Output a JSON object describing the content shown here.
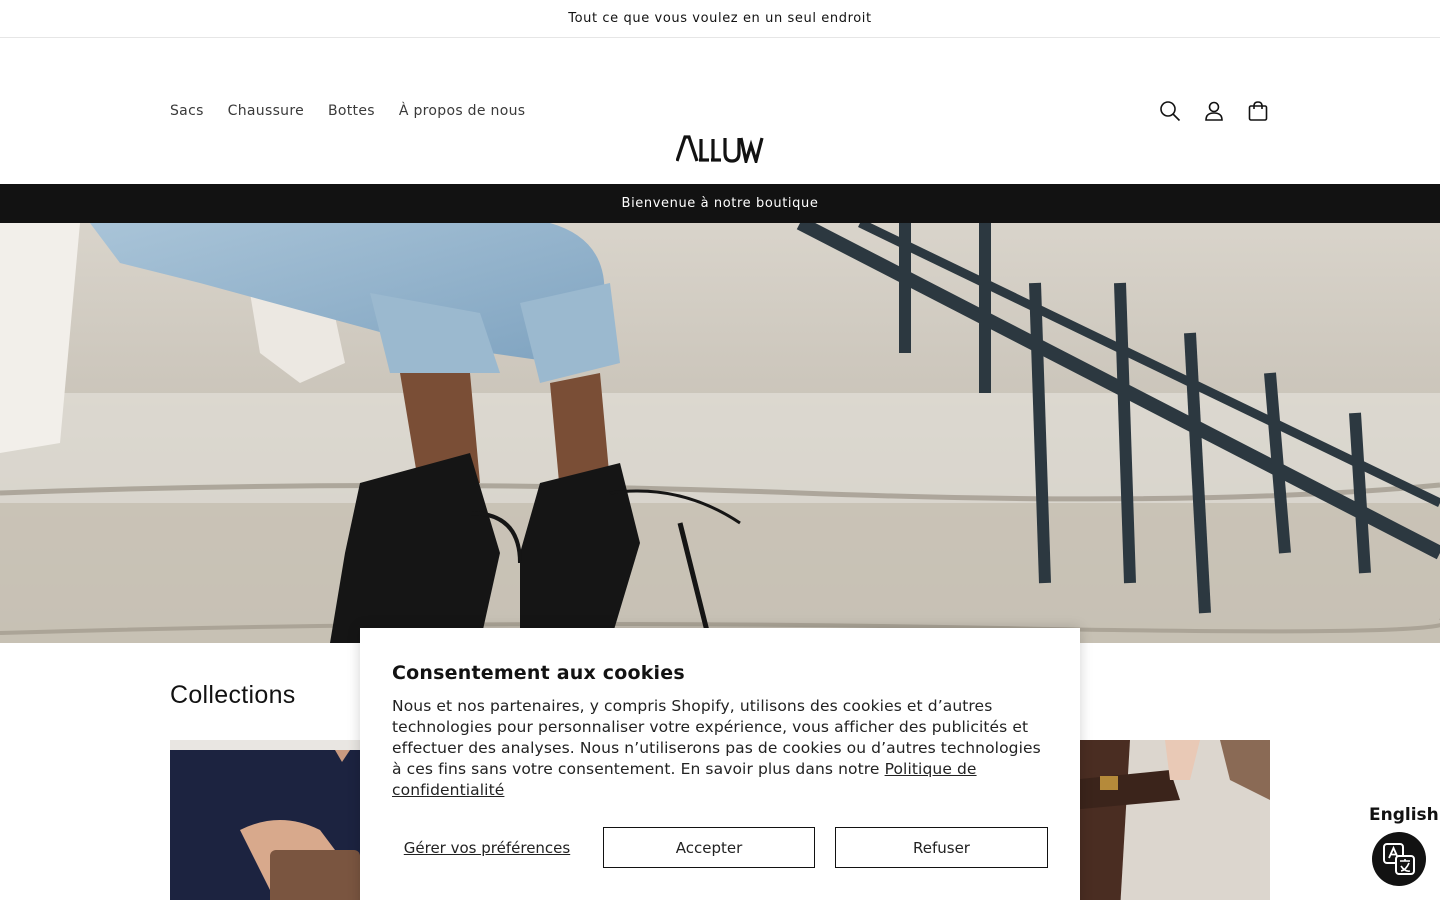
{
  "announcement": "Tout ce que vous voulez en un seul endroit",
  "header": {
    "nav": [
      "Sacs",
      "Chaussure",
      "Bottes",
      "À propos de nous"
    ],
    "logo_text": "ALLUW"
  },
  "welcome_bar": "Bienvenue à notre boutique",
  "collections": {
    "title": "Collections"
  },
  "cookie": {
    "title": "Consentement aux cookies",
    "body": "Nous et nos partenaires, y compris Shopify, utilisons des cookies et d’autres technologies pour personnaliser votre expérience, vous afficher des publicités et effectuer des analyses. Nous n’utiliserons pas de cookies ou d’autres technologies à ces fins sans votre consentement. En savoir plus dans notre ",
    "link": "Politique de confidentialité",
    "prefs": "Gérer vos préférences",
    "accept": "Accepter",
    "refuse": "Refuser"
  },
  "language": {
    "label": "English"
  },
  "colors": {
    "text": "#121212",
    "welcome_bg": "#121212",
    "background": "#ffffff"
  }
}
